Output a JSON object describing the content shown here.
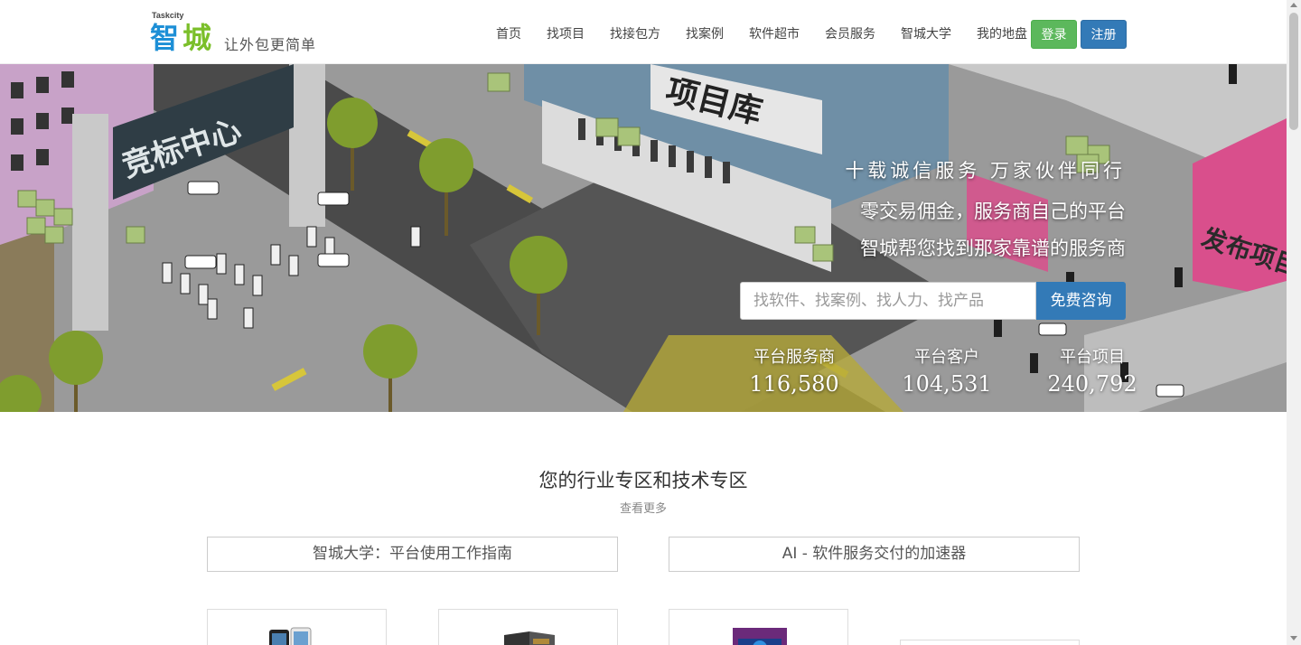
{
  "header": {
    "logo": {
      "small_text": "Taskcity",
      "brand_part1": "智",
      "brand_part2": "城",
      "slogan": "让外包更简单"
    },
    "nav": [
      "首页",
      "找项目",
      "找接包方",
      "找案例",
      "软件超市",
      "会员服务",
      "智城大学",
      "我的地盘"
    ],
    "login_label": "登录",
    "register_label": "注册"
  },
  "hero": {
    "scene_signs": {
      "bidding_center": "竞标中心",
      "project_library": "项目库",
      "publish_project": "发布项目"
    },
    "tagline1": "十载诚信服务 万家伙伴同行",
    "tagline2": "零交易佣金，服务商自己的平台",
    "tagline3": "智城帮您找到那家靠谱的服务商",
    "search": {
      "placeholder": "找软件、找案例、找人力、找产品",
      "button_label": "免费咨询"
    },
    "stats": [
      {
        "label": "平台服务商",
        "value": "116,580"
      },
      {
        "label": "平台客户",
        "value": "104,531"
      },
      {
        "label": "平台项目",
        "value": "240,792"
      }
    ]
  },
  "section": {
    "title": "您的行业专区和技术专区",
    "more": "查看更多",
    "banners": [
      "智城大学：平台使用工作指南",
      "AI - 软件服务交付的加速器"
    ]
  },
  "colors": {
    "login_green": "#5cb85c",
    "register_blue": "#337ab7",
    "brand_blue": "#1d8fd6",
    "brand_green": "#7bbf2a"
  }
}
